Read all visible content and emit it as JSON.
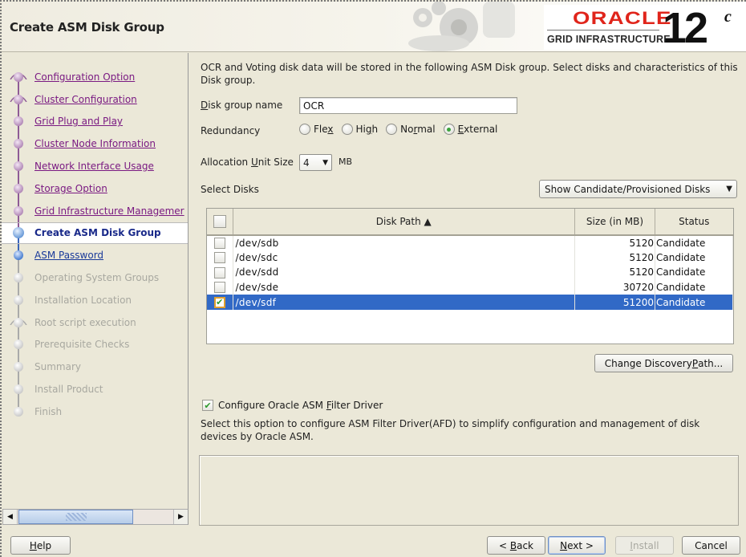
{
  "window": {
    "title": "Create ASM Disk Group",
    "brand": {
      "vendor": "ORACLE",
      "product": "GRID INFRASTRUCTURE",
      "version": "12",
      "version_suffix": "c",
      "brand_color": "#e0251b"
    }
  },
  "sidebar": {
    "steps": [
      {
        "label": "Configuration Option",
        "state": "done",
        "icon": "fork-node-icon"
      },
      {
        "label": "Cluster Configuration",
        "state": "done",
        "icon": "fork-node-icon"
      },
      {
        "label": "Grid Plug and Play",
        "state": "done",
        "icon": "node-icon"
      },
      {
        "label": "Cluster Node Information",
        "state": "done",
        "icon": "node-icon"
      },
      {
        "label": "Network Interface Usage",
        "state": "done",
        "icon": "node-icon"
      },
      {
        "label": "Storage Option",
        "state": "done",
        "icon": "node-icon"
      },
      {
        "label": "Grid Infrastructure Managemer",
        "state": "done",
        "icon": "node-icon"
      },
      {
        "label": "Create ASM Disk Group",
        "state": "current",
        "icon": "current-node-icon"
      },
      {
        "label": "ASM Password",
        "state": "next",
        "icon": "node-icon"
      },
      {
        "label": "Operating System Groups",
        "state": "todo",
        "icon": "node-icon"
      },
      {
        "label": "Installation Location",
        "state": "todo",
        "icon": "node-icon"
      },
      {
        "label": "Root script execution",
        "state": "todo",
        "icon": "fork-node-icon"
      },
      {
        "label": "Prerequisite Checks",
        "state": "todo",
        "icon": "node-icon"
      },
      {
        "label": "Summary",
        "state": "todo",
        "icon": "node-icon"
      },
      {
        "label": "Install Product",
        "state": "todo",
        "icon": "node-icon"
      },
      {
        "label": "Finish",
        "state": "todo",
        "icon": "node-icon"
      }
    ],
    "scrollbar": {
      "left_arrow": "◀",
      "right_arrow": "▶"
    }
  },
  "main": {
    "intro": "OCR and Voting disk data will be stored in the following ASM Disk group. Select disks and characteristics of this Disk group.",
    "disk_group_name": {
      "label_mnemonic": "D",
      "label_rest": "isk group name",
      "value": "OCR"
    },
    "redundancy": {
      "label": "Redundancy",
      "options": [
        {
          "pre": "Fle",
          "mn": "x",
          "post": "",
          "selected": false
        },
        {
          "pre": "Hi",
          "mn": "g",
          "post": "h",
          "selected": false
        },
        {
          "pre": "No",
          "mn": "r",
          "post": "mal",
          "selected": false
        },
        {
          "pre": "",
          "mn": "E",
          "post": "xternal",
          "selected": true
        }
      ]
    },
    "allocation_unit": {
      "label_pre": "Allocation ",
      "label_mn": "U",
      "label_post": "nit Size",
      "value": "4",
      "unit": "MB",
      "caret": "▼"
    },
    "select_disks_label": "Select Disks",
    "filter_dropdown": {
      "value": "Show Candidate/Provisioned Disks",
      "caret": "▼"
    },
    "table": {
      "columns": [
        "Disk Path ▲",
        "Size (in MB)",
        "Status"
      ],
      "rows": [
        {
          "checked": false,
          "path": "/dev/sdb",
          "size": "5120",
          "status": "Candidate",
          "selected": false
        },
        {
          "checked": false,
          "path": "/dev/sdc",
          "size": "5120",
          "status": "Candidate",
          "selected": false
        },
        {
          "checked": false,
          "path": "/dev/sdd",
          "size": "5120",
          "status": "Candidate",
          "selected": false
        },
        {
          "checked": false,
          "path": "/dev/sde",
          "size": "30720",
          "status": "Candidate",
          "selected": false
        },
        {
          "checked": true,
          "path": "/dev/sdf",
          "size": "51200",
          "status": "Candidate",
          "selected": true
        }
      ]
    },
    "change_discovery": {
      "pre": "Change Discovery ",
      "mn": "P",
      "post": "ath..."
    },
    "afd": {
      "checked": true,
      "label_pre": "Configure Oracle ASM ",
      "label_mn": "F",
      "label_post": "ilter Driver",
      "description": "Select this option to configure ASM Filter Driver(AFD) to simplify configuration and management of disk devices by Oracle ASM."
    }
  },
  "footer": {
    "help": {
      "mn": "H",
      "post": "elp"
    },
    "back": {
      "pre": "< ",
      "mn": "B",
      "post": "ack"
    },
    "next": {
      "pre": "",
      "mn": "N",
      "post": "ext >"
    },
    "install": {
      "pre": "",
      "mn": "I",
      "post": "nstall",
      "disabled": true
    },
    "cancel": "Cancel"
  }
}
